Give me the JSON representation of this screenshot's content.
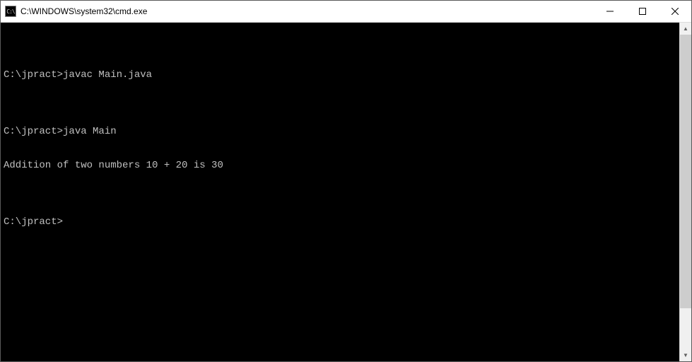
{
  "window": {
    "title": "C:\\WINDOWS\\system32\\cmd.exe",
    "icon_label": "C:\\"
  },
  "terminal": {
    "lines": [
      "",
      "C:\\jpract>javac Main.java",
      "",
      "C:\\jpract>java Main",
      "Addition of two numbers 10 + 20 is 30",
      "",
      "C:\\jpract>"
    ]
  }
}
